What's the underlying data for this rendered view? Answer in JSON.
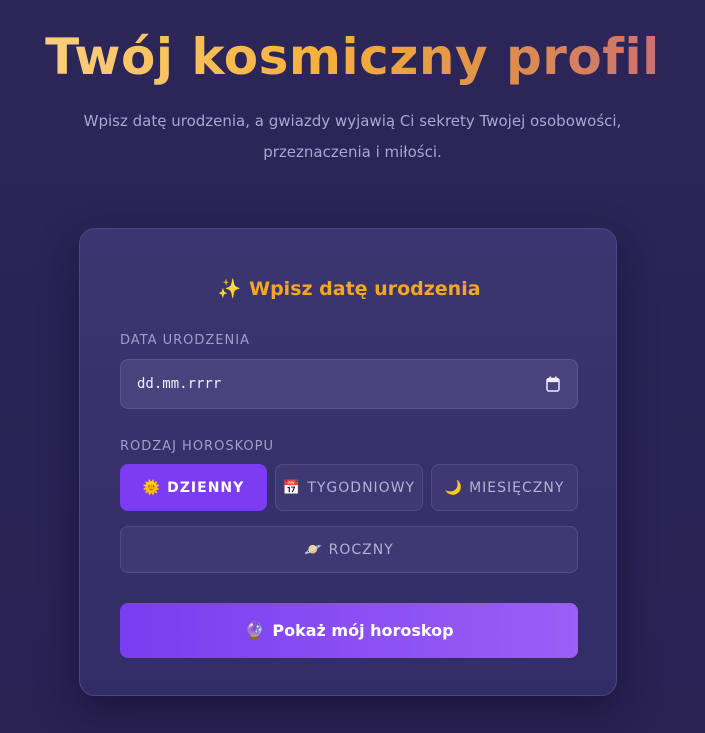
{
  "header": {
    "title": "Twój kosmiczny profil",
    "subtitle_line1": "Wpisz datę urodzenia, a gwiazdy wyjawią Ci sekrety Twojej osobowości,",
    "subtitle_line2": "przeznaczenia i miłości."
  },
  "form": {
    "title_icon": "✨",
    "title": "Wpisz datę urodzenia",
    "date_label": "DATA URODZENIA",
    "date_value": "dd.mm.rrrr",
    "date_icon": "calendar-icon",
    "type_label": "RODZAJ HOROSKOPU",
    "options": [
      {
        "icon": "🌞",
        "label": "DZIENNY",
        "active": true
      },
      {
        "icon": "📅",
        "label": "TYGODNIOWY",
        "active": false
      },
      {
        "icon": "🌙",
        "label": "MIESIĘCZNY",
        "active": false
      },
      {
        "icon": "🪐",
        "label": "ROCZNY",
        "active": false
      }
    ],
    "submit_icon": "🔮",
    "submit_label": "Pokaż mój horoskop"
  },
  "colors": {
    "accent": "#7b3cf2",
    "card_title": "#f5a623",
    "background": "#2a2456"
  }
}
